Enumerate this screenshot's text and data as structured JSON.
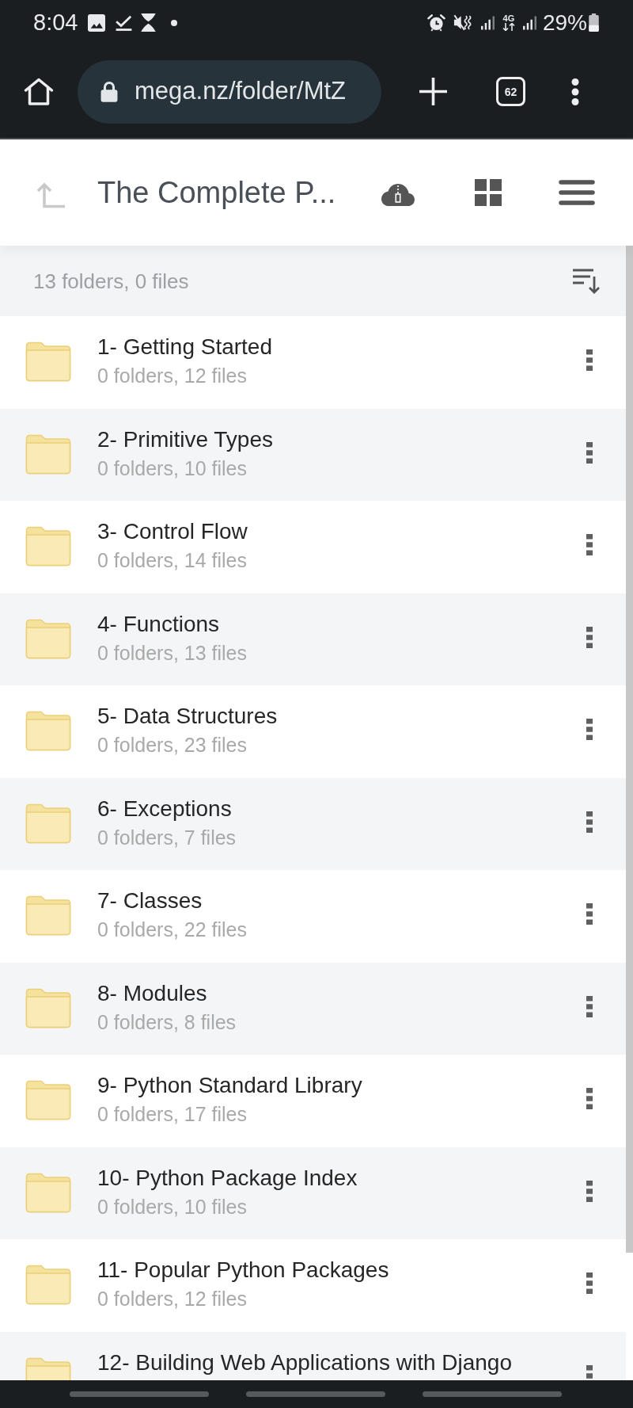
{
  "status_bar": {
    "time": "8:04",
    "network": "4G",
    "battery": "29%"
  },
  "browser": {
    "url": "mega.nz/folder/MtZ",
    "tab_count": "62"
  },
  "header": {
    "title": "The Complete P...",
    "up_disabled": true
  },
  "summary": "13 folders, 0 files",
  "folders": [
    {
      "name": "1- Getting Started",
      "details": "0 folders, 12 files"
    },
    {
      "name": "2- Primitive Types",
      "details": "0 folders, 10 files"
    },
    {
      "name": "3- Control Flow",
      "details": "0 folders, 14 files"
    },
    {
      "name": "4- Functions",
      "details": "0 folders, 13 files"
    },
    {
      "name": "5- Data Structures",
      "details": "0 folders, 23 files"
    },
    {
      "name": "6- Exceptions",
      "details": "0 folders, 7 files"
    },
    {
      "name": "7- Classes",
      "details": "0 folders, 22 files"
    },
    {
      "name": "8- Modules",
      "details": "0 folders, 8 files"
    },
    {
      "name": "9- Python Standard Library",
      "details": "0 folders, 17 files"
    },
    {
      "name": "10- Python Package Index",
      "details": "0 folders, 10 files"
    },
    {
      "name": "11- Popular Python Packages",
      "details": "0 folders, 12 files"
    },
    {
      "name": "12- Building Web Applications with Django"
    }
  ]
}
